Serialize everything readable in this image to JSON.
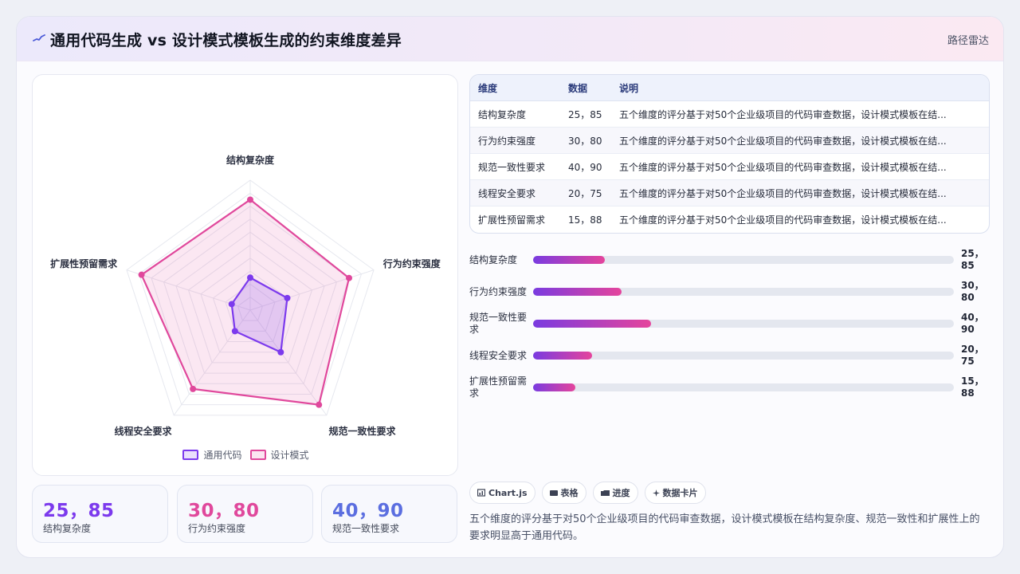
{
  "header": {
    "title": "通用代码生成 vs 设计模式模板生成的约束维度差异",
    "kind_label": "路径雷达",
    "icon": "wave-icon"
  },
  "legend": {
    "items": [
      {
        "label": "通用代码",
        "color": "#7c3aed"
      },
      {
        "label": "设计模式",
        "color": "#e0489c"
      }
    ]
  },
  "stats": [
    {
      "value": "25，85",
      "label": "结构复杂度",
      "color": "#7c3aed"
    },
    {
      "value": "30，80",
      "label": "行为约束强度",
      "color": "#e0489c"
    },
    {
      "value": "40，90",
      "label": "规范一致性要求",
      "color": "#5b6ee0"
    }
  ],
  "table": {
    "headers": [
      "维度",
      "数据",
      "说明"
    ],
    "rows": [
      {
        "dim": "结构复杂度",
        "data": "25，85",
        "note": "五个维度的评分基于对50个企业级项目的代码审查数据，设计模式模板在结..."
      },
      {
        "dim": "行为约束强度",
        "data": "30，80",
        "note": "五个维度的评分基于对50个企业级项目的代码审查数据，设计模式模板在结..."
      },
      {
        "dim": "规范一致性要求",
        "data": "40，90",
        "note": "五个维度的评分基于对50个企业级项目的代码审查数据，设计模式模板在结..."
      },
      {
        "dim": "线程安全要求",
        "data": "20，75",
        "note": "五个维度的评分基于对50个企业级项目的代码审查数据，设计模式模板在结..."
      },
      {
        "dim": "扩展性预留需求",
        "data": "15，88",
        "note": "五个维度的评分基于对50个企业级项目的代码审查数据，设计模式模板在结..."
      }
    ]
  },
  "bars": [
    {
      "label": "结构复杂度",
      "value": "25，85",
      "fill": 0.17
    },
    {
      "label": "行为约束强度",
      "value": "30，80",
      "fill": 0.21
    },
    {
      "label": "规范一致性要求",
      "value": "40，90",
      "fill": 0.28
    },
    {
      "label": "线程安全要求",
      "value": "20，75",
      "fill": 0.14
    },
    {
      "label": "扩展性预留需求",
      "value": "15，88",
      "fill": 0.1
    }
  ],
  "chips": [
    {
      "icon": "chart-icon",
      "label": "Chart.js"
    },
    {
      "icon": "table-icon",
      "label": "表格"
    },
    {
      "icon": "progress-icon",
      "label": "进度"
    },
    {
      "icon": "sparkle-icon",
      "label": "数据卡片"
    }
  ],
  "description": "五个维度的评分基于对50个企业级项目的代码审查数据，设计模式模板在结构复杂度、规范一致性和扩展性上的要求明显高于通用代码。",
  "chart_data": {
    "type": "radar",
    "categories": [
      "结构复杂度",
      "行为约束强度",
      "规范一致性要求",
      "线程安全要求",
      "扩展性预留需求"
    ],
    "series": [
      {
        "name": "通用代码",
        "values": [
          25,
          30,
          40,
          20,
          15
        ],
        "color": "#7c3aed"
      },
      {
        "name": "设计模式",
        "values": [
          85,
          80,
          90,
          75,
          88
        ],
        "color": "#e0489c"
      }
    ],
    "range": [
      0,
      100
    ],
    "grid": true,
    "legend_position": "bottom"
  }
}
